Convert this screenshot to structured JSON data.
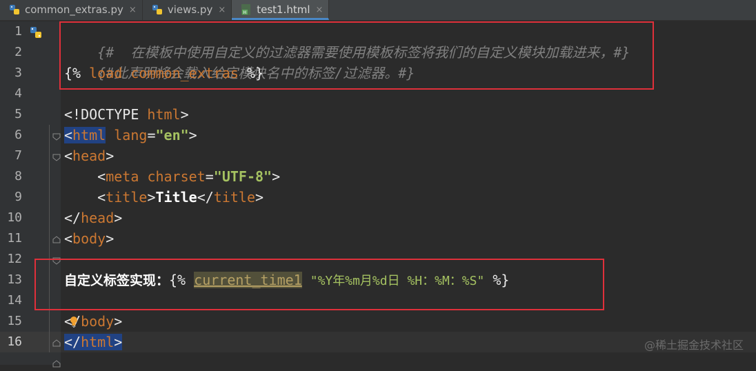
{
  "tabs": [
    {
      "label": "common_extras.py",
      "close": "×"
    },
    {
      "label": "views.py",
      "close": "×"
    },
    {
      "label": "test1.html",
      "close": "×"
    }
  ],
  "line_numbers": [
    "1",
    "2",
    "3",
    "4",
    "5",
    "6",
    "7",
    "8",
    "9",
    "10",
    "11",
    "12",
    "13",
    "14",
    "15",
    "16"
  ],
  "code": {
    "l1": "{#  在模板中使用自定义的过滤器需要使用模板标签将我们的自定义模块加载进来，#}",
    "l2": "{#此声明将会载入给定模块名中的标签/过滤器。#}",
    "l3_open": "{%",
    "l3_kw": "load",
    "l3_mod": "common_extras",
    "l3_close": "%}",
    "l5_a": "<!DOCTYPE ",
    "l5_b": "html",
    "l5_c": ">",
    "l6_lt": "<",
    "l6_tag": "html",
    "l6_attr": "lang",
    "l6_eq": "=",
    "l6_val": "\"en\"",
    "l6_gt": ">",
    "l7_lt": "<",
    "l7_tag": "head",
    "l7_gt": ">",
    "l8_lt": "<",
    "l8_tag": "meta",
    "l8_attr": "charset",
    "l8_eq": "=",
    "l8_val": "\"UTF-8\"",
    "l8_gt": ">",
    "l9_lt": "<",
    "l9_tag": "title",
    "l9_gt": ">",
    "l9_text": "Title",
    "l9_clt": "</",
    "l9_ctag": "title",
    "l9_cgt": ">",
    "l10_lt": "</",
    "l10_tag": "head",
    "l10_gt": ">",
    "l11_lt": "<",
    "l11_tag": "body",
    "l11_gt": ">",
    "l13_text": "自定义标签实现：",
    "l13_open": "{%",
    "l13_fn": "current_time1",
    "l13_arg": "\"%Y年%m月%d日 %H：%M：%S\"",
    "l13_close": "%}",
    "l15_lt": "</",
    "l15_tag": "body",
    "l15_gt": ">",
    "l16_lt": "</",
    "l16_tag": "html",
    "l16_gt": ">"
  },
  "watermark": "@稀土掘金技术社区",
  "colors": {
    "background": "#2b2b2b",
    "comment": "#808080",
    "tag": "#e8bf6a",
    "string": "#a5c261",
    "keyword": "#cc7832",
    "highlight_box": "#e0303a"
  }
}
